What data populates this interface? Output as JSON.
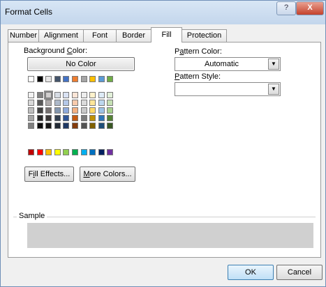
{
  "window": {
    "title": "Format Cells",
    "help_label": "?",
    "close_label": "X"
  },
  "tabs": [
    {
      "label": "Number"
    },
    {
      "label": "Alignment"
    },
    {
      "label": "Font"
    },
    {
      "label": "Border"
    },
    {
      "label": "Fill"
    },
    {
      "label": "Protection"
    }
  ],
  "active_tab": "Fill",
  "fill": {
    "background_color_label": "Background Color:",
    "no_color_label": "No Color",
    "fill_effects_label": "Fill Effects...",
    "more_colors_label": "More Colors...",
    "pattern_color_label": "Pattern Color:",
    "pattern_color_value": "Automatic",
    "pattern_style_label": "Pattern Style:",
    "pattern_style_value": "",
    "sample_label": "Sample",
    "sample_color": "#d0d0d0"
  },
  "palette": {
    "theme_top": [
      "#ffffff",
      "#000000",
      "#e7e6e6",
      "#44546a",
      "#4472c4",
      "#ed7d31",
      "#a5a5a5",
      "#ffc000",
      "#5b9bd5",
      "#70ad47"
    ],
    "theme_shades": [
      [
        "#f2f2f2",
        "#808080",
        "#d0cece",
        "#d6dce4",
        "#d9e2f3",
        "#fbe5d6",
        "#ededed",
        "#fff2cc",
        "#deebf7",
        "#e2f0d9"
      ],
      [
        "#d9d9d9",
        "#595959",
        "#aeaaaa",
        "#adb9ca",
        "#b4c7e7",
        "#f8cbad",
        "#dbdbdb",
        "#ffe699",
        "#bdd7ee",
        "#c5e0b4"
      ],
      [
        "#bfbfbf",
        "#404040",
        "#767171",
        "#8497b0",
        "#8faadc",
        "#f4b183",
        "#c9c9c9",
        "#ffd966",
        "#9dc3e6",
        "#a9d18e"
      ],
      [
        "#a6a6a6",
        "#262626",
        "#3b3838",
        "#333f50",
        "#2f5597",
        "#c55a11",
        "#7b7b7b",
        "#bf9000",
        "#2e75b6",
        "#548235"
      ],
      [
        "#808080",
        "#0d0d0d",
        "#171717",
        "#222a35",
        "#1f3864",
        "#843c0c",
        "#525252",
        "#7f6000",
        "#1f4e79",
        "#385723"
      ]
    ],
    "standard": [
      "#c00000",
      "#ff0000",
      "#ffc000",
      "#ffff00",
      "#92d050",
      "#00b050",
      "#00b0f0",
      "#0070c0",
      "#002060",
      "#7030a0"
    ],
    "selected": "#d0cece"
  },
  "footer": {
    "ok_label": "OK",
    "cancel_label": "Cancel"
  }
}
